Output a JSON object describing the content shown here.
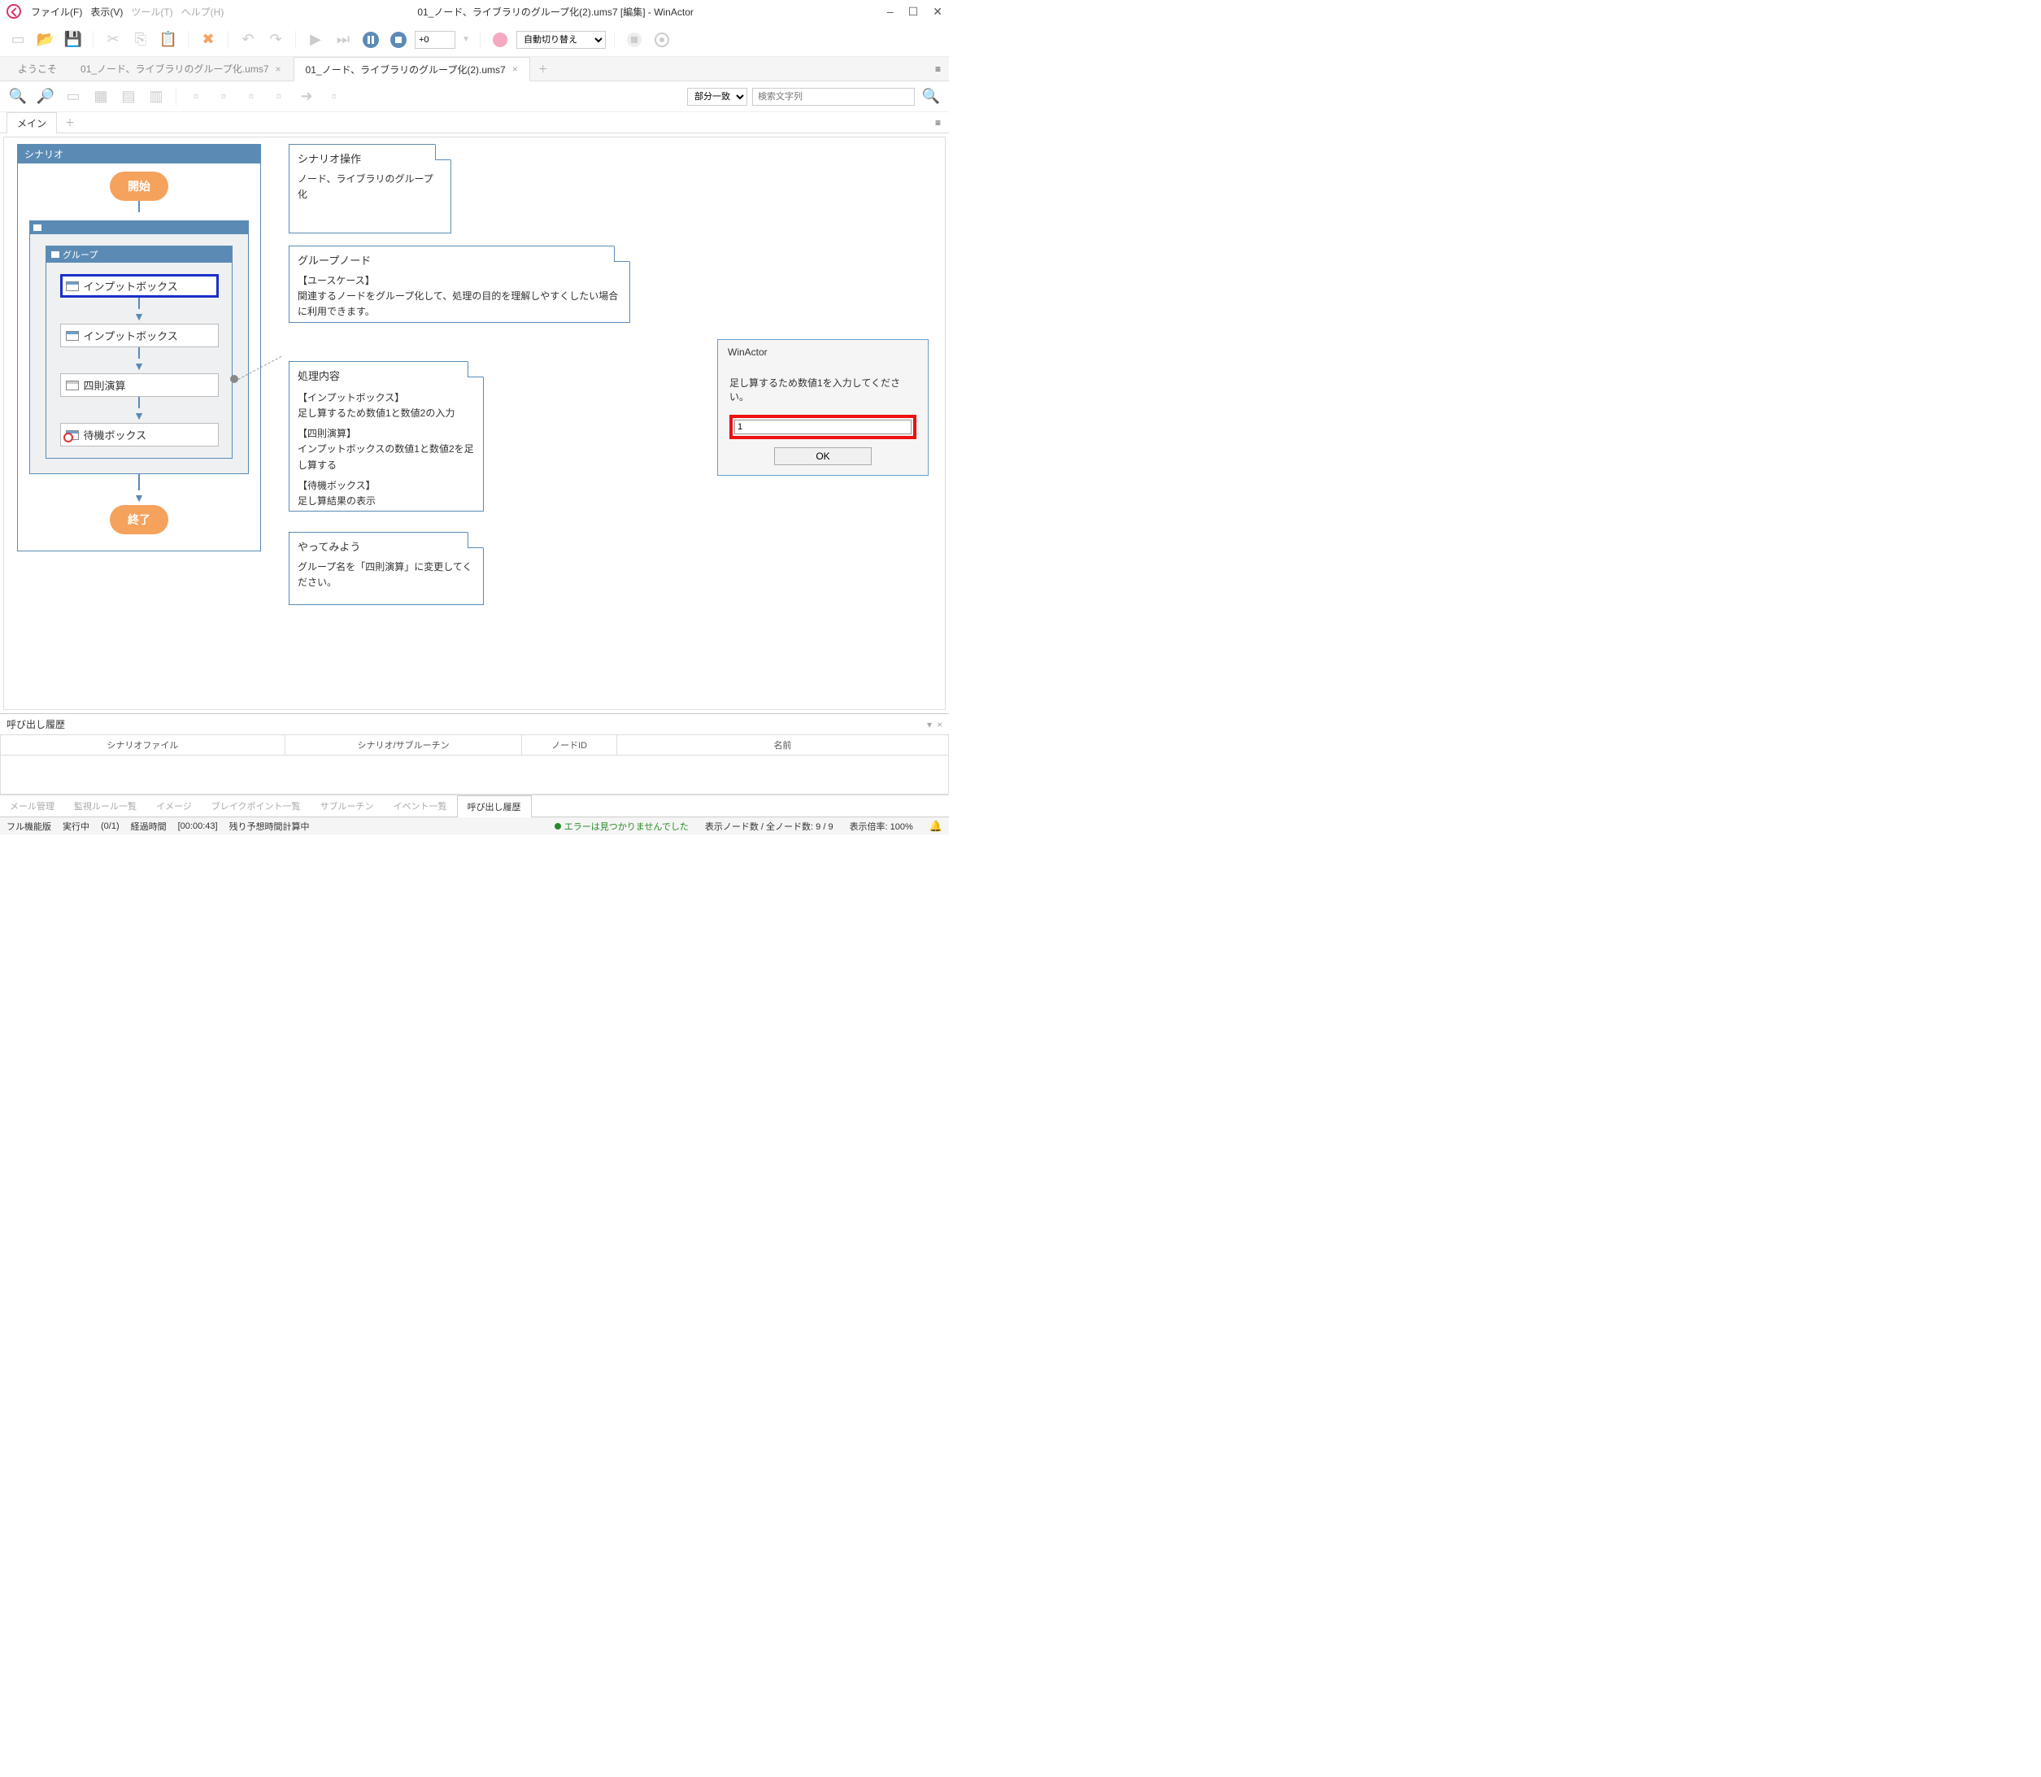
{
  "window": {
    "title": "01_ノード、ライブラリのグループ化(2).ums7 [編集] - WinActor",
    "minimize": "–",
    "maximize": "☐",
    "close": "✕"
  },
  "menu": {
    "file": "ファイル(F)",
    "view": "表示(V)",
    "tool": "ツール(T)",
    "help": "ヘルプ(H)"
  },
  "toolbar": {
    "speed": "+0",
    "mode": "自動切り替え"
  },
  "tabs": {
    "welcome": "ようこそ",
    "file1": "01_ノード、ライブラリのグループ化.ums7",
    "file2": "01_ノード、ライブラリのグループ化(2).ums7"
  },
  "search": {
    "match_mode": "部分一致",
    "placeholder": "検索文字列"
  },
  "subtabs": {
    "main": "メイン"
  },
  "scenario": {
    "title": "シナリオ",
    "start": "開始",
    "end": "終了",
    "group_label": "グループ",
    "nodes": {
      "input1": "インプットボックス",
      "input2": "インプットボックス",
      "calc": "四則演算",
      "wait": "待機ボックス"
    }
  },
  "notes": {
    "n1": {
      "title": "シナリオ操作",
      "line1": "ノード、ライブラリのグループ化"
    },
    "n2": {
      "title": "グループノード",
      "h1": "【ユースケース】",
      "b1": "関連するノードをグループ化して、処理の目的を理解しやすくしたい場合に利用できます。"
    },
    "n3": {
      "title": "処理内容",
      "h1": "【インプットボックス】",
      "b1": "足し算するため数値1と数値2の入力",
      "h2": "【四則演算】",
      "b2": "インプットボックスの数値1と数値2を足し算する",
      "h3": "【待機ボックス】",
      "b3": "足し算結果の表示"
    },
    "n4": {
      "title": "やってみよう",
      "b1": "グループ名を「四則演算」に変更してください。"
    }
  },
  "dialog": {
    "title": "WinActor",
    "message": "足し算するため数値1を入力してください。",
    "value": "1",
    "ok": "OK"
  },
  "callhist": {
    "title": "呼び出し履歴",
    "cols": {
      "file": "シナリオファイル",
      "sub": "シナリオ/サブルーチン",
      "nodeid": "ノードID",
      "name": "名前"
    }
  },
  "bottom_tabs": {
    "mail": "メール管理",
    "rules": "監視ルール一覧",
    "image": "イメージ",
    "bp": "ブレイクポイント一覧",
    "subr": "サブルーチン",
    "event": "イベント一覧",
    "call": "呼び出し履歴"
  },
  "status": {
    "edition": "フル機能版",
    "running": "実行中",
    "progress": "(0/1)",
    "elapsed_label": "経過時間",
    "elapsed": "[00:00:43]",
    "remaining": "残り予想時間計算中",
    "errors": "エラーは見つかりませんでした",
    "nodes": "表示ノード数 / 全ノード数: 9 / 9",
    "zoom": "表示倍率: 100%"
  }
}
